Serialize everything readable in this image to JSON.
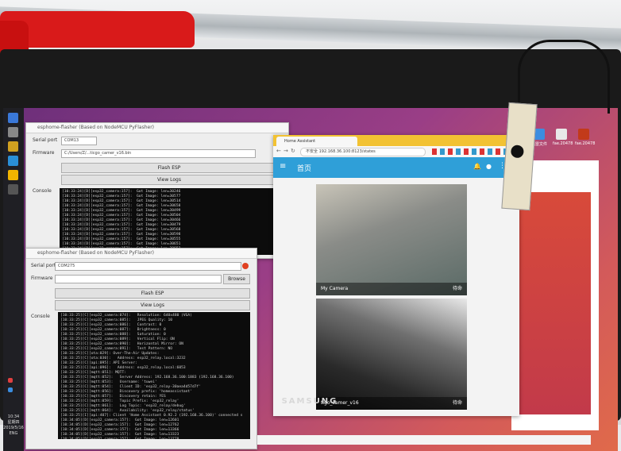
{
  "monitor": {
    "brand": "SAMSUNG"
  },
  "taskbar": {
    "time": "10:34",
    "day": "星期四",
    "date": "2019/5/16",
    "lang": "ENG"
  },
  "desktop_icons": [
    "迅雷文件",
    "fae.20478",
    "fae.20478"
  ],
  "esptool_back": {
    "title": "esphome-flasher (Based on NodeMCU PyFlasher)",
    "serial_label": "Serial port",
    "serial_value": "COM13",
    "firmware_label": "Firmware",
    "firmware_value": "C:/Users/Z/...ticgo_camer_v16.bin",
    "flash_button": "Flash ESP",
    "logs_button": "View Logs",
    "console_label": "Console",
    "console_lines": [
      "[10:33:24][D][esp32_camera:157]:  Got Image: len=30246",
      "[10:33:24][D][esp32_camera:157]:  Got Image: len=30577",
      "[10:33:24][D][esp32_camera:157]:  Got Image: len=30514",
      "[10:33:24][D][esp32_camera:157]:  Got Image: len=30658",
      "[10:33:24][D][esp32_camera:157]:  Got Image: len=30499",
      "[10:33:24][D][esp32_camera:157]:  Got Image: len=30504",
      "[10:33:24][D][esp32_camera:157]:  Got Image: len=30466",
      "[10:33:24][D][esp32_camera:157]:  Got Image: len=30479",
      "[10:33:24][D][esp32_camera:157]:  Got Image: len=30568",
      "[10:33:24][D][esp32_camera:157]:  Got Image: len=30598",
      "[10:33:24][D][esp32_camera:157]:  Got Image: len=30555",
      "[10:33:24][D][esp32_camera:157]:  Got Image: len=30651",
      "[10:33:24][D][esp32_camera:157]:  Got Image: len=30652"
    ]
  },
  "esptool_front": {
    "title": "esphome-flasher (Based on NodeMCU PyFlasher)",
    "serial_label": "Serial port",
    "serial_value": "COM275",
    "firmware_label": "Firmware",
    "browse_button": "Browse",
    "flash_button": "Flash ESP",
    "logs_button": "View Logs",
    "console_label": "Console",
    "console_lines": [
      "[10:33:25][C][esp32_camera:074]:   Resolution: 640x480 (VGA)",
      "[10:33:25][C][esp32_camera:085]:   JPEG Quality: 10",
      "[10:33:25][C][esp32_camera:086]:   Contrast: 0",
      "[10:33:25][C][esp32_camera:087]:   Brightness: 0",
      "[10:33:25][C][esp32_camera:088]:   Saturation: 0",
      "[10:33:25][C][esp32_camera:089]:   Vertical Flip: ON",
      "[10:33:25][C][esp32_camera:090]:   Horizontal Mirror: ON",
      "[10:33:25][C][esp32_camera:091]:   Test Pattern: NO",
      "[10:33:25][C][ota:029]: Over-The-Air Updates:",
      "[10:33:25][C][ota:030]:   Address: esp32_relay.local:3232",
      "[10:33:25][C][api:095]: API Server:",
      "[10:33:25][C][api:096]:   Address: esp32_relay.local:6053",
      "[10:33:25][C][mqtt:051]: MQTT:",
      "[10:33:25][C][mqtt:052]:   Server Address: 192.168.36.100:1883 (192.168.36.100)",
      "[10:33:25][C][mqtt:053]:   Username: 'tuwei'",
      "[10:33:25][C][mqtt:054]:   Client ID: 'esp32_relay-30aea4d57d7f'",
      "[10:33:25][C][mqtt:056]:   Discovery prefix: 'homeassistant'",
      "[10:33:25][C][mqtt:057]:   Discovery retain: YES",
      "[10:33:25][C][mqtt:059]:   Topic Prefix: 'esp32_relay'",
      "[10:33:25][C][mqtt:061]:   Log Topic: 'esp32_relay/debug'",
      "[10:33:25][C][mqtt:064]:   Availability: 'esp32_relay/status'",
      "[10:33:25][I][api:407]: Client 'Home Assistant 0.92.2 (192.168.36.100)' connected s",
      "[10:34:05][D][esp32_camera:157]:  Got Image: len=12601",
      "[10:34:05][D][esp32_camera:157]:  Got Image: len=12762",
      "[10:34:05][D][esp32_camera:157]:  Got Image: len=13366",
      "[10:34:05][D][esp32_camera:157]:  Got Image: len=13323",
      "[10:34:05][D][esp32_camera:157]:  Got Image: len=13778",
      "[10:34:05][D][esp32_camera:157]:  Got Image: len=12889"
    ]
  },
  "browser": {
    "tab_title": "Home Assistant",
    "url_prefix": "不安全",
    "url": "192.168.36.100:8123/states",
    "page_title": "首页",
    "cards": [
      {
        "name": "My Camera",
        "status": "待命"
      },
      {
        "name": "tigo_camer_v16",
        "status": "待命"
      }
    ]
  },
  "colors": {
    "appbar": "#2f9fd8",
    "tabstrip": "#f2c233",
    "console_bg": "#0c0c0c"
  }
}
